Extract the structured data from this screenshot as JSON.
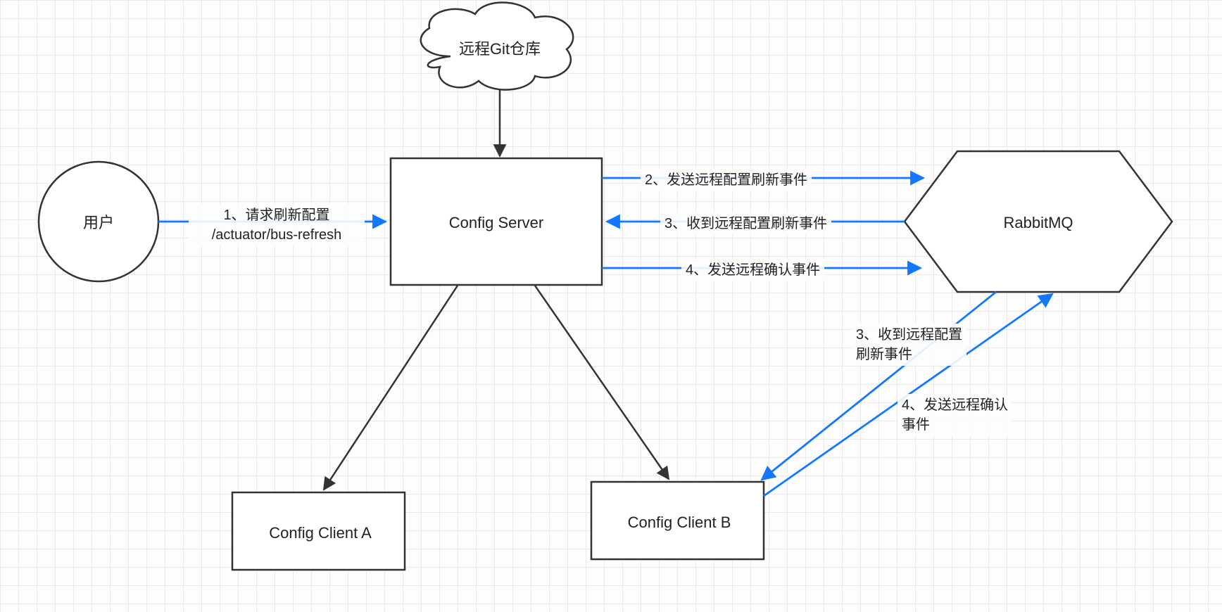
{
  "nodes": {
    "user": "用户",
    "git": "远程Git仓库",
    "configServer": "Config Server",
    "rabbitmq": "RabbitMQ",
    "clientA": "Config Client A",
    "clientB": "Config Client B"
  },
  "edges": {
    "userToServer_line1": "1、请求刷新配置",
    "userToServer_line2": "/actuator/bus-refresh",
    "serverToMQ_2": "2、发送远程配置刷新事件",
    "mqToServer_3": "3、收到远程配置刷新事件",
    "serverToMQ_4": "4、发送远程确认事件",
    "mqToClientB_3_line1": "3、收到远程配置",
    "mqToClientB_3_line2": "刷新事件",
    "clientBToMQ_4_line1": "4、发送远程确认",
    "clientBToMQ_4_line2": "事件"
  },
  "colors": {
    "stroke": "#333333",
    "blue": "#1178ff"
  }
}
